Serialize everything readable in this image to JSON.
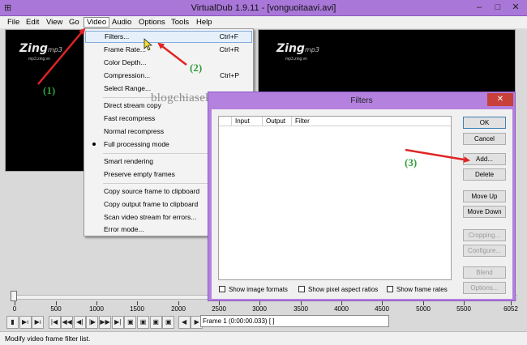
{
  "window": {
    "title": "VirtualDub 1.9.11 - [vonguoitaavi.avi]",
    "app_icon": "film-icon",
    "controls": [
      "–",
      "□",
      "✕"
    ]
  },
  "menubar": [
    "File",
    "Edit",
    "View",
    "Go",
    "Video",
    "Audio",
    "Options",
    "Tools",
    "Help"
  ],
  "video_panes": {
    "logo": "Zing",
    "logo_mp3": "mp3",
    "logo_sub": "mp3.zing.vn"
  },
  "video_menu": {
    "items": [
      {
        "label": "Filters...",
        "shortcut": "Ctrl+F"
      },
      {
        "label": "Frame Rate...",
        "shortcut": "Ctrl+R"
      },
      {
        "label": "Color Depth...",
        "shortcut": ""
      },
      {
        "label": "Compression...",
        "shortcut": "Ctrl+P"
      },
      {
        "label": "Select Range...",
        "shortcut": ""
      },
      {
        "label": "Direct stream copy",
        "shortcut": ""
      },
      {
        "label": "Fast recompress",
        "shortcut": ""
      },
      {
        "label": "Normal recompress",
        "shortcut": ""
      },
      {
        "label": "Full processing mode",
        "shortcut": ""
      },
      {
        "label": "Smart rendering",
        "shortcut": ""
      },
      {
        "label": "Preserve empty frames",
        "shortcut": ""
      },
      {
        "label": "Copy source frame to clipboard",
        "shortcut": ""
      },
      {
        "label": "Copy output frame to clipboard",
        "shortcut": ""
      },
      {
        "label": "Scan video stream for errors...",
        "shortcut": ""
      },
      {
        "label": "Error mode...",
        "shortcut": ""
      }
    ]
  },
  "dialog": {
    "title": "Filters",
    "close": "✕",
    "columns": [
      "Input",
      "Output",
      "Filter"
    ],
    "buttons": {
      "ok": "OK",
      "cancel": "Cancel",
      "add": "Add...",
      "delete": "Delete",
      "move_up": "Move Up",
      "move_down": "Move Down",
      "cropping": "Cropping...",
      "configure": "Configure...",
      "blend": "Blend",
      "options": "Options..."
    },
    "checkboxes": [
      "Show image formats",
      "Show pixel aspect ratios",
      "Show frame rates"
    ]
  },
  "timeline": {
    "ticks": [
      "0",
      "500",
      "1000",
      "1500",
      "2000",
      "2500",
      "3000",
      "3500",
      "4000",
      "4500",
      "5000",
      "5500",
      "6052"
    ],
    "frame_field": "Frame 1 (0:00:00.033) [ ]"
  },
  "toolbar": [
    "▮",
    "▶ı",
    "▶ı",
    "|◀",
    "◀◀",
    "◀|",
    "|▶",
    "▶▶",
    "▶|",
    "▣",
    "▣",
    "▣",
    "▣",
    "◀",
    "▶"
  ],
  "status": "Modify video frame filter list.",
  "annotations": {
    "step1": "(1)",
    "step2": "(2)",
    "step3": "(3)",
    "watermark": "blogchiasekienthuc.com"
  },
  "colors": {
    "title_bar": "#a977d8",
    "dialog_frame": "#b481df",
    "arrow": "#e02424",
    "annotation": "#2f9e3b",
    "close_button": "#c7413a"
  }
}
